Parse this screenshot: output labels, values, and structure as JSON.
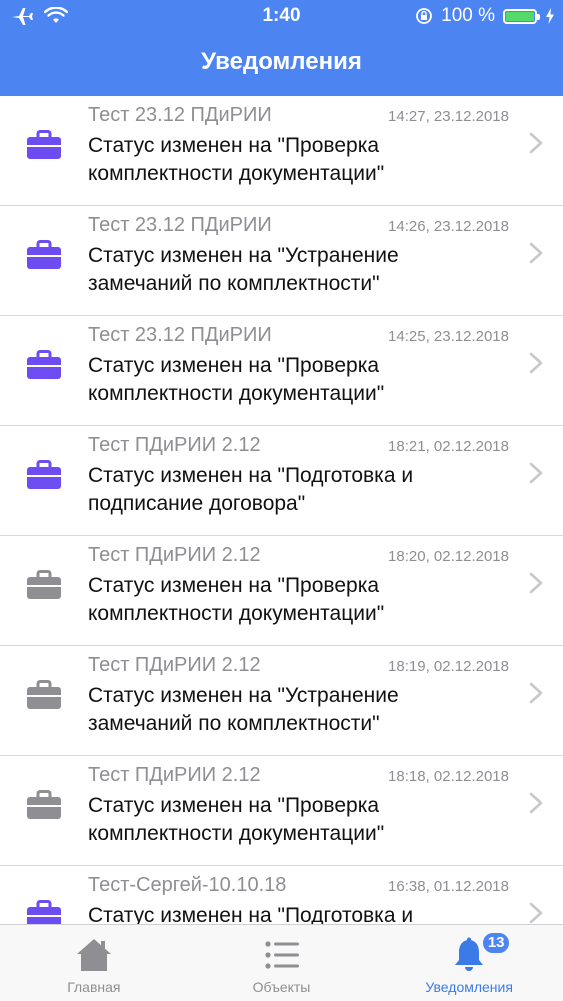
{
  "status_bar": {
    "time": "1:40",
    "battery": "100 %",
    "icons": [
      "airplane-icon",
      "wifi-icon",
      "orientation-lock-icon",
      "battery-icon",
      "charging-icon"
    ]
  },
  "nav": {
    "title": "Уведомления"
  },
  "colors": {
    "header": "#4c84f1",
    "icon_active": "#6d4df2",
    "icon_inactive": "#8e8e93",
    "tab_active": "#3b7be8"
  },
  "notifications": [
    {
      "project": "Тест 23.12 ПДиРИИ",
      "time": "14:27, 23.12.2018",
      "message": "Статус изменен на \"Проверка комплектности документации\"",
      "icon": "briefcase-icon",
      "unread": true
    },
    {
      "project": "Тест 23.12 ПДиРИИ",
      "time": "14:26, 23.12.2018",
      "message": "Статус изменен на \"Устранение замечаний по комплектности\"",
      "icon": "briefcase-icon",
      "unread": true
    },
    {
      "project": "Тест 23.12 ПДиРИИ",
      "time": "14:25, 23.12.2018",
      "message": "Статус изменен на \"Проверка комплектности документации\"",
      "icon": "briefcase-icon",
      "unread": true
    },
    {
      "project": "Тест ПДиРИИ 2.12",
      "time": "18:21, 02.12.2018",
      "message": "Статус изменен на \"Подготовка и подписание договора\"",
      "icon": "briefcase-icon",
      "unread": true
    },
    {
      "project": "Тест ПДиРИИ 2.12",
      "time": "18:20, 02.12.2018",
      "message": "Статус изменен на \"Проверка комплектности документации\"",
      "icon": "briefcase-icon",
      "unread": false
    },
    {
      "project": "Тест ПДиРИИ 2.12",
      "time": "18:19, 02.12.2018",
      "message": "Статус изменен на \"Устранение замечаний по комплектности\"",
      "icon": "briefcase-icon",
      "unread": false
    },
    {
      "project": "Тест ПДиРИИ 2.12",
      "time": "18:18, 02.12.2018",
      "message": "Статус изменен на \"Проверка комплектности документации\"",
      "icon": "briefcase-icon",
      "unread": false
    },
    {
      "project": "Тест-Сергей-10.10.18",
      "time": "16:38, 01.12.2018",
      "message": "Статус изменен на \"Подготовка и",
      "icon": "briefcase-icon",
      "unread": true
    }
  ],
  "tabbar": {
    "tabs": [
      {
        "label": "Главная",
        "icon": "home-icon",
        "active": false
      },
      {
        "label": "Объекты",
        "icon": "list-icon",
        "active": false
      },
      {
        "label": "Уведомления",
        "icon": "bell-icon",
        "active": true,
        "badge": "13"
      }
    ]
  }
}
